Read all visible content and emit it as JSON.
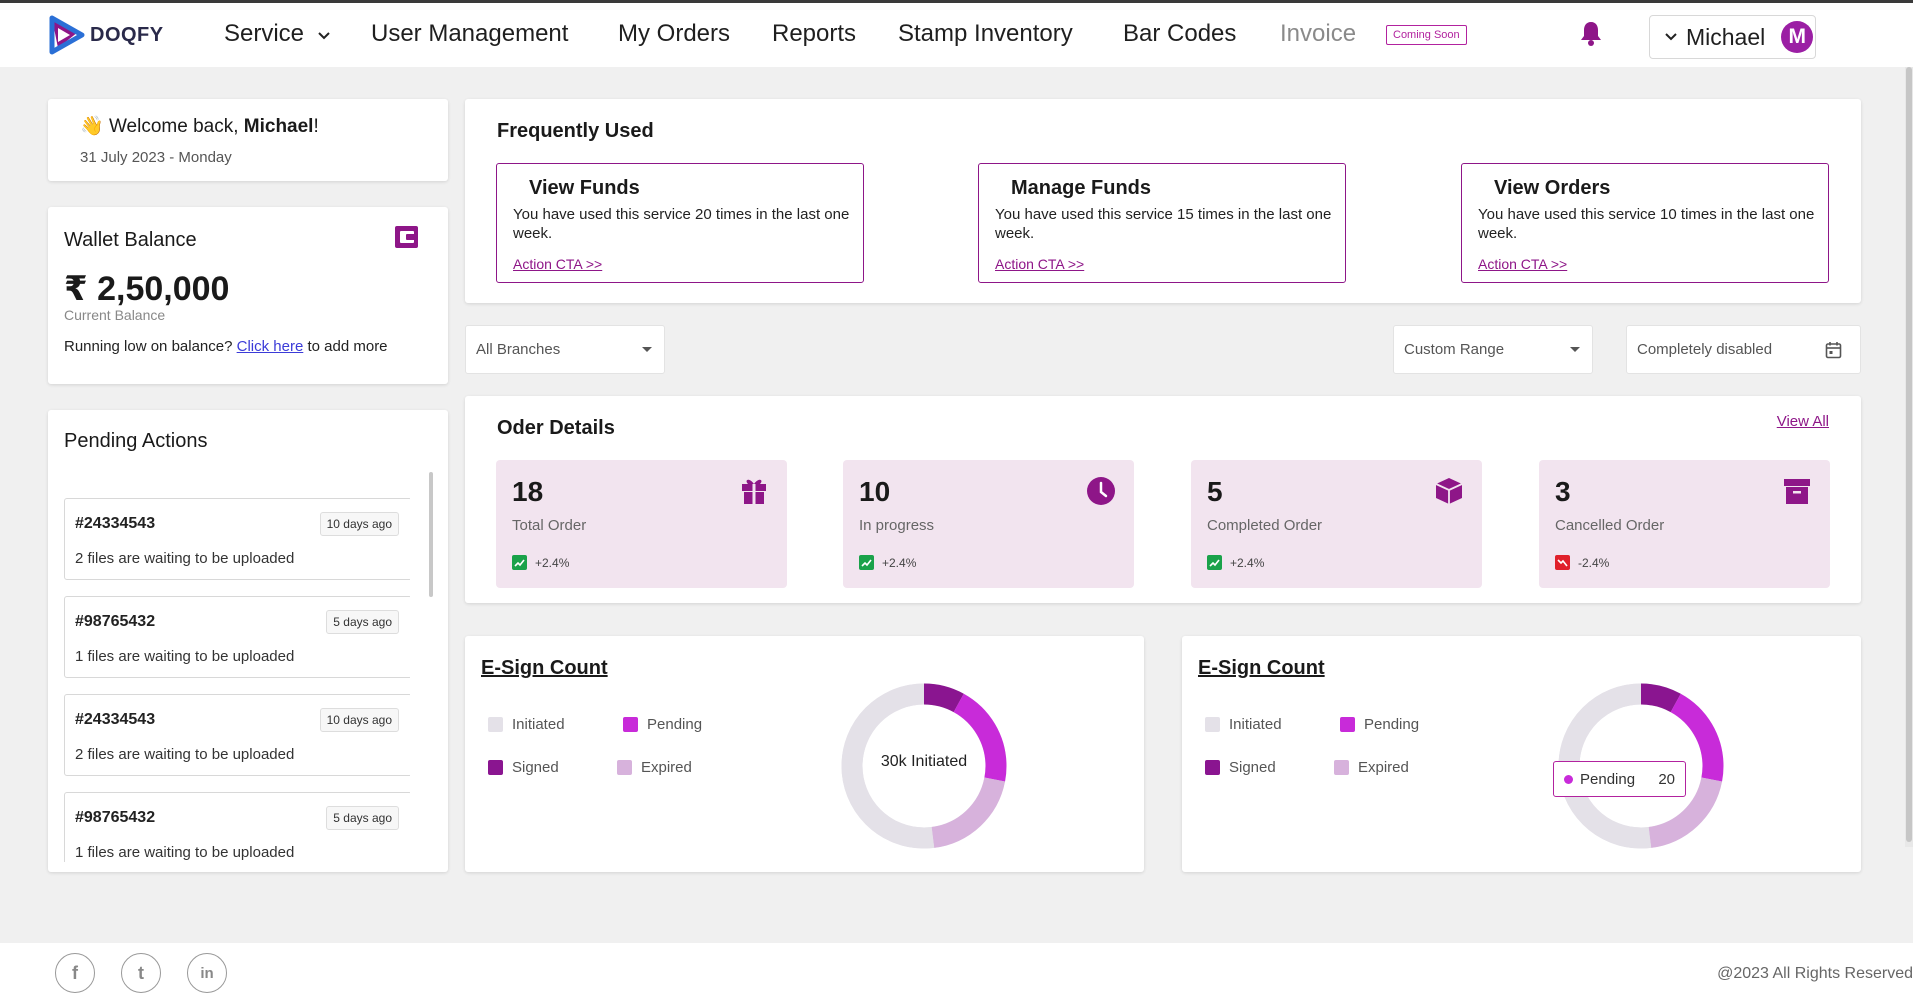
{
  "brand": {
    "name": "DOQFY",
    "accent": "#8e1688",
    "accent_bright": "#c82bd9"
  },
  "nav": {
    "service": "Service",
    "user_management": "User Management",
    "my_orders": "My Orders",
    "reports": "Reports",
    "stamp_inventory": "Stamp Inventory",
    "bar_codes": "Bar Codes",
    "invoice": "Invoice",
    "coming_soon": "Coming Soon",
    "user_name": "Michael",
    "avatar_letter": "M"
  },
  "welcome": {
    "prefix": "Welcome back, ",
    "name": "Michael",
    "suffix": "!",
    "emoji": "👋",
    "date": "31 July 2023 - Monday"
  },
  "wallet": {
    "title": "Wallet Balance",
    "amount": "₹ 2,50,000",
    "subtitle": "Current Balance",
    "note_prefix": "Running low on balance? ",
    "note_link": "Click here",
    "note_suffix": " to add more"
  },
  "pending": {
    "title": "Pending Actions",
    "items": [
      {
        "id": "#24334543",
        "age": "10 days ago",
        "desc": "2 files are waiting to be uploaded"
      },
      {
        "id": "#98765432",
        "age": "5 days ago",
        "desc": "1 files are waiting to be uploaded"
      },
      {
        "id": "#24334543",
        "age": "10 days ago",
        "desc": "2 files are waiting to be uploaded"
      },
      {
        "id": "#98765432",
        "age": "5 days ago",
        "desc": "1 files are waiting to be uploaded"
      }
    ]
  },
  "frequently_used": {
    "title": "Frequently Used",
    "items": [
      {
        "title": "View Funds",
        "desc": "You have used this service 20 times in the last one week.",
        "cta": "Action CTA >>"
      },
      {
        "title": "Manage Funds",
        "desc": "You have used this service 15 times in the last one week.",
        "cta": "Action CTA >>"
      },
      {
        "title": "View Orders",
        "desc": "You have used this service 10 times in the last one week.",
        "cta": "Action CTA >>"
      }
    ]
  },
  "filters": {
    "branches": "All Branches",
    "range": "Custom Range",
    "date": "Completely disabled"
  },
  "order_details": {
    "title": "Oder Details",
    "view_all": "View All",
    "stats": [
      {
        "value": "18",
        "label": "Total Order",
        "trend": "+2.4%",
        "direction": "up",
        "icon": "gift-box-icon"
      },
      {
        "value": "10",
        "label": "In progress",
        "trend": "+2.4%",
        "direction": "up",
        "icon": "clock-icon"
      },
      {
        "value": "5",
        "label": "Completed Order",
        "trend": "+2.4%",
        "direction": "up",
        "icon": "package-icon"
      },
      {
        "value": "3",
        "label": "Cancelled Order",
        "trend": "-2.4%",
        "direction": "down",
        "icon": "archive-icon"
      }
    ]
  },
  "esign": [
    {
      "title": "E-Sign Count",
      "legend": {
        "initiated": "Initiated",
        "pending": "Pending",
        "signed": "Signed",
        "expired": "Expired"
      },
      "center_label": "30k Initiated"
    },
    {
      "title": "E-Sign Count",
      "legend": {
        "initiated": "Initiated",
        "pending": "Pending",
        "signed": "Signed",
        "expired": "Expired"
      },
      "tooltip": {
        "label": "Pending",
        "value": "20"
      }
    }
  ],
  "chart_data": {
    "type": "pie",
    "categories": [
      "Signed",
      "Pending",
      "Expired",
      "Initiated"
    ],
    "values": [
      8,
      20,
      20,
      52
    ],
    "colors": [
      "#8a1590",
      "#c82bd9",
      "#d7b2dc",
      "#e4e1e8"
    ]
  },
  "colors": {
    "signed": "#8a1590",
    "pending": "#c82bd9",
    "expired": "#d7b2dc",
    "initiated": "#e4e1e8",
    "up": "#1aa24a",
    "down": "#e0202b"
  },
  "footer": {
    "copyright": "@2023 All Rights Reserved",
    "social": [
      "f",
      "t",
      "in"
    ]
  }
}
